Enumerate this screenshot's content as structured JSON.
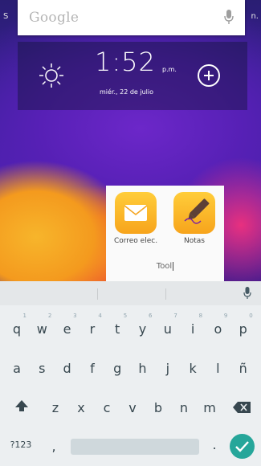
{
  "status_bar": {
    "left_text": "S",
    "right_text": "n."
  },
  "search_bar": {
    "logo_text": "Google",
    "mic_icon": "mic-icon"
  },
  "clock_widget": {
    "weather_icon": "sun-icon",
    "time": "1:52",
    "ampm": "p.m.",
    "date": "miér., 22 de julio",
    "add_icon": "add-circle-icon"
  },
  "folder": {
    "name": "Tool",
    "apps": [
      {
        "label": "Correo elec.",
        "icon": "email-icon"
      },
      {
        "label": "Notas",
        "icon": "notes-pencil-icon"
      }
    ]
  },
  "keyboard": {
    "row1": [
      {
        "k": "q",
        "hint": "1"
      },
      {
        "k": "w",
        "hint": "2"
      },
      {
        "k": "e",
        "hint": "3"
      },
      {
        "k": "r",
        "hint": "4"
      },
      {
        "k": "t",
        "hint": "5"
      },
      {
        "k": "y",
        "hint": "6"
      },
      {
        "k": "u",
        "hint": "7"
      },
      {
        "k": "i",
        "hint": "8"
      },
      {
        "k": "o",
        "hint": "9"
      },
      {
        "k": "p",
        "hint": "0"
      }
    ],
    "row2": [
      "a",
      "s",
      "d",
      "f",
      "g",
      "h",
      "j",
      "k",
      "l",
      "ñ"
    ],
    "row3": [
      "z",
      "x",
      "c",
      "v",
      "b",
      "n",
      "m"
    ],
    "symbols_key": "?123",
    "comma_key": ",",
    "period_key": ".",
    "icons": {
      "shift": "shift-icon",
      "backspace": "backspace-icon",
      "enter": "check-icon",
      "mic": "mic-icon"
    },
    "accent_color": "#26a69a"
  }
}
